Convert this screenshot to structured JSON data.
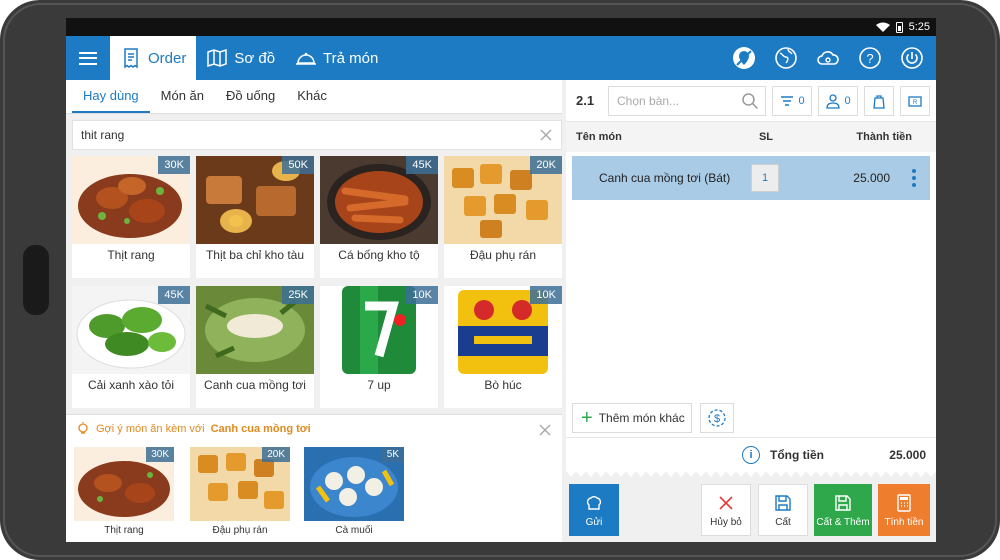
{
  "status": {
    "time": "5:25"
  },
  "nav": {
    "tabs": [
      {
        "label": "Order",
        "icon": "receipt-icon"
      },
      {
        "label": "Sơ đồ",
        "icon": "map-icon"
      },
      {
        "label": "Trả món",
        "icon": "cloche-icon"
      }
    ],
    "right_icons": [
      "location-off-icon",
      "globe-icon",
      "cloud-icon",
      "help-icon",
      "power-icon"
    ]
  },
  "categories": [
    "Hay dùng",
    "Món ăn",
    "Đồ uống",
    "Khác"
  ],
  "search": {
    "value": "thit rang"
  },
  "menu_items": [
    {
      "name": "Thịt rang",
      "price": "30K"
    },
    {
      "name": "Thịt ba chỉ kho tàu",
      "price": "50K"
    },
    {
      "name": "Cá bống kho tộ",
      "price": "45K"
    },
    {
      "name": "Đậu phụ rán",
      "price": "20K"
    },
    {
      "name": "Cải xanh xào tỏi",
      "price": "45K"
    },
    {
      "name": "Canh cua mồng tơi",
      "price": "25K"
    },
    {
      "name": "7 up",
      "price": "10K"
    },
    {
      "name": "Bò húc",
      "price": "10K"
    }
  ],
  "suggest": {
    "prefix": "Gợi ý món ăn kèm với",
    "dish": "Canh cua mồng tơi",
    "items": [
      {
        "name": "Thịt rang",
        "price": "30K"
      },
      {
        "name": "Đậu phụ rán",
        "price": "20K"
      },
      {
        "name": "Cà muối",
        "price": "5K"
      }
    ]
  },
  "order": {
    "table": "2.1",
    "table_placeholder": "Chọn bàn...",
    "filter_count": "0",
    "guest_count": "0",
    "columns": {
      "name": "Tên món",
      "qty": "SL",
      "total": "Thành tiền"
    },
    "rows": [
      {
        "name": "Canh cua mồng tơi (Bát)",
        "qty": "1",
        "total": "25.000"
      }
    ],
    "add_other": "Thêm món khác",
    "total_label": "Tổng tiền",
    "total_value": "25.000"
  },
  "actions": {
    "send": "Gửi",
    "cancel": "Hủy bỏ",
    "save": "Cất",
    "save_add": "Cất & Thêm",
    "pay": "Tính tiền"
  },
  "colors": {
    "primary": "#1d7bc4",
    "green": "#2ea84a",
    "orange": "#ee7d2e",
    "selected_row": "#aacbe6",
    "suggest_text": "#e08a1e"
  }
}
